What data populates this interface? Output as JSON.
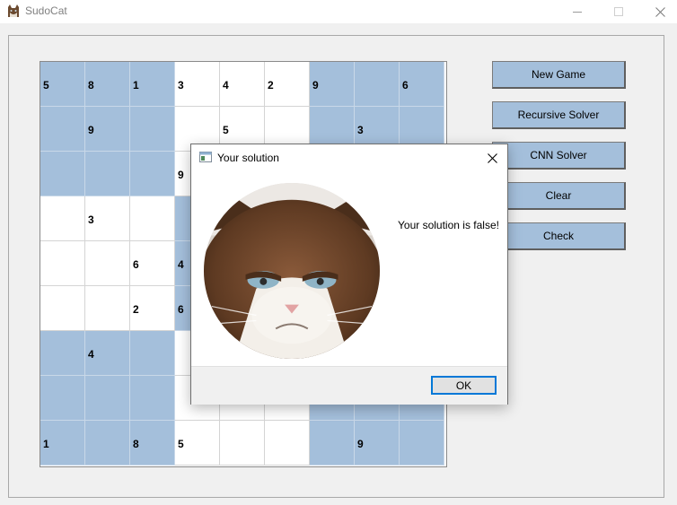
{
  "window": {
    "title": "SudoCat",
    "icons": {
      "app": "cat-icon",
      "minimize": "minimize-icon",
      "maximize": "maximize-icon",
      "close": "close-icon"
    }
  },
  "board": {
    "cells": [
      [
        "5",
        "8",
        "1",
        "3",
        "4",
        "2",
        "9",
        "",
        "6"
      ],
      [
        "",
        "9",
        "",
        "",
        "5",
        "",
        "",
        "3",
        ""
      ],
      [
        "",
        "",
        "",
        "9",
        "",
        "",
        "",
        "",
        ""
      ],
      [
        "",
        "3",
        "",
        "",
        "",
        "",
        "",
        "",
        ""
      ],
      [
        "",
        "",
        "6",
        "4",
        "",
        "",
        "",
        "",
        ""
      ],
      [
        "",
        "",
        "2",
        "6",
        "",
        "",
        "",
        "",
        ""
      ],
      [
        "",
        "4",
        "",
        "",
        "",
        "",
        "",
        "",
        ""
      ],
      [
        "",
        "",
        "",
        "",
        "",
        "",
        "",
        "",
        ""
      ],
      [
        "1",
        "",
        "8",
        "5",
        "",
        "",
        "",
        "9",
        ""
      ]
    ],
    "shade_color": "#a4bfdb"
  },
  "buttons": {
    "new_game": "New Game",
    "recursive_solver": "Recursive Solver",
    "cnn_solver": "CNN Solver",
    "clear": "Clear",
    "check": "Check"
  },
  "dialog": {
    "title": "Your solution",
    "message": "Your solution is false!",
    "ok_label": "OK",
    "image": "grumpy-cat-photo",
    "icons": {
      "window": "window-icon",
      "close": "close-icon"
    }
  },
  "colors": {
    "accent": "#a4bfdb",
    "focus_border": "#0078d7",
    "background": "#f0f0f0"
  }
}
